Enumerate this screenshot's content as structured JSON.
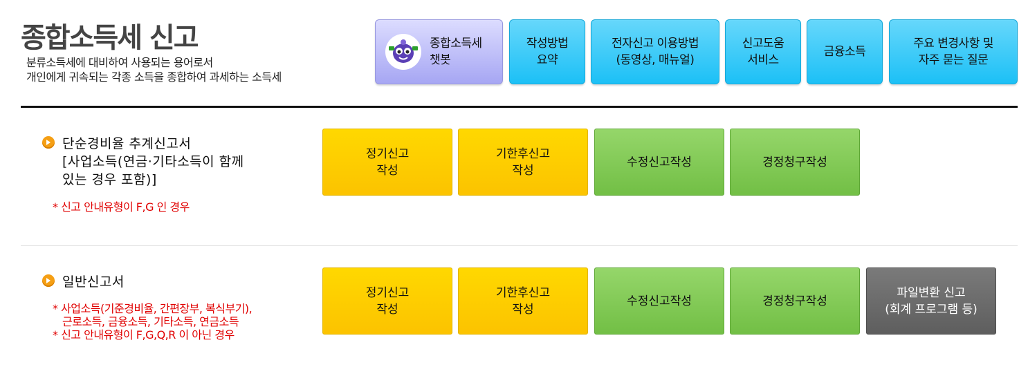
{
  "header": {
    "title": "종합소득세 신고",
    "desc_line1": "분류소득세에 대비하여 사용되는 용어로서",
    "desc_line2": "개인에게 귀속되는 각종 소득을 종합하여 과세하는 소득세"
  },
  "top_buttons": {
    "chatbot_l1": "종합소득세",
    "chatbot_l2": "챗봇",
    "summary_l1": "작성방법",
    "summary_l2": "요약",
    "efiling_l1": "전자신고 이용방법",
    "efiling_l2": "(동영상, 매뉴얼)",
    "help_l1": "신고도움",
    "help_l2": "서비스",
    "finance": "금융소득",
    "faq_l1": "주요 변경사항 및",
    "faq_l2": "자주 묻는 질문"
  },
  "section1": {
    "title_l1": "단순경비율 추계신고서",
    "title_l2": "[사업소득(연금·기타소득이 함께",
    "title_l3": "있는 경우 포함)]",
    "note": "* 신고 안내유형이 F,G 인 경우",
    "btn_regular_l1": "정기신고",
    "btn_regular_l2": "작성",
    "btn_late_l1": "기한후신고",
    "btn_late_l2": "작성",
    "btn_amend": "수정신고작성",
    "btn_claim": "경정청구작성"
  },
  "section2": {
    "title": "일반신고서",
    "note_l1": "* 사업소득(기준경비율, 간편장부, 복식부기),",
    "note_l2": "근로소득, 금융소득, 기타소득, 연금소득",
    "note_l3": "* 신고 안내유형이 F,G,Q,R 이 아닌 경우",
    "btn_regular_l1": "정기신고",
    "btn_regular_l2": "작성",
    "btn_late_l1": "기한후신고",
    "btn_late_l2": "작성",
    "btn_amend": "수정신고작성",
    "btn_claim": "경정청구작성",
    "btn_file_l1": "파일변환 신고",
    "btn_file_l2": "(회계 프로그램 등)"
  },
  "colors": {
    "blue_button": "#1cc0f6",
    "chatbot_button": "#a6a6f3",
    "yellow_button": "#fcc300",
    "green_button": "#72bf45",
    "gray_button": "#5e5e5e",
    "note_red": "#e00000",
    "bullet_orange": "#f59f14"
  },
  "icons": {
    "chatbot": "chatbot-mascot-icon",
    "bullet": "orange-arrow-bullet-icon"
  }
}
